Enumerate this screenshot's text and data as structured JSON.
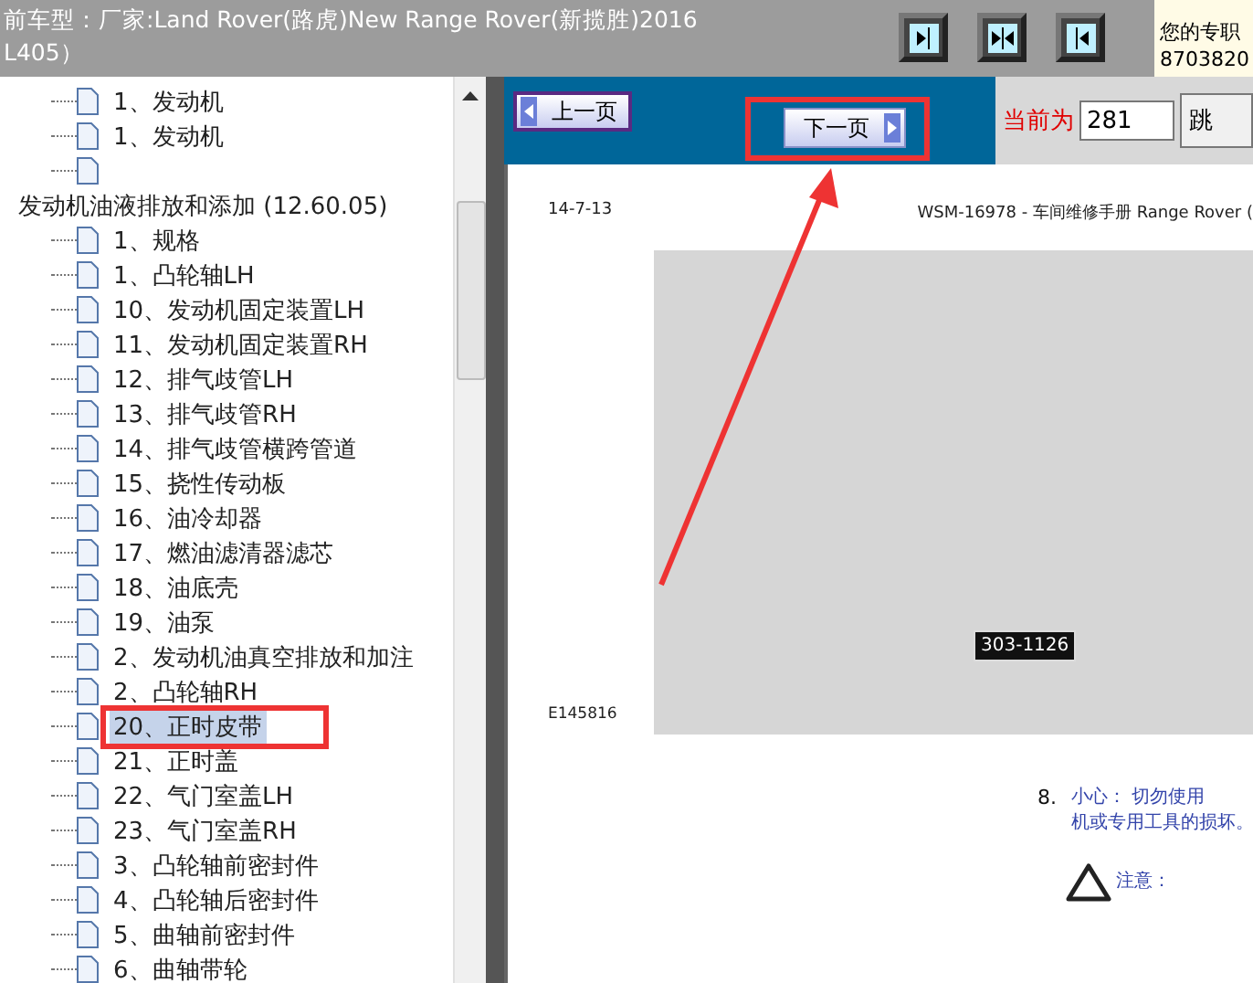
{
  "header": {
    "title_lines": [
      "前车型：厂家:Land Rover(路虎)New Range Rover(新揽胜)2016",
      "L405）"
    ],
    "nav_buttons": [
      {
        "kind": "right"
      },
      {
        "kind": "both"
      },
      {
        "kind": "left"
      }
    ],
    "info_lines": [
      "您的专职",
      "8703820"
    ]
  },
  "tree": [
    {
      "children": [
        {
          "label": "1、发动机",
          "selected": false
        },
        {
          "label": "1、发动机",
          "selected": false
        },
        {
          "selected": false
        }
      ]
    },
    {
      "label": "发动机油液排放和添加 (12.60.05)",
      "expanded": true,
      "children": [
        {
          "label": "1、规格",
          "selected": false
        },
        {
          "label": "1、凸轮轴LH",
          "selected": false
        },
        {
          "label": "10、发动机固定装置LH",
          "selected": false
        },
        {
          "label": "11、发动机固定装置RH",
          "selected": false
        },
        {
          "label": "12、排气歧管LH",
          "selected": false
        },
        {
          "label": "13、排气歧管RH",
          "selected": false
        },
        {
          "label": "14、排气歧管横跨管道",
          "selected": false
        },
        {
          "label": "15、挠性传动板",
          "selected": false
        },
        {
          "label": "16、油冷却器",
          "selected": false
        },
        {
          "label": "17、燃油滤清器滤芯",
          "selected": false
        },
        {
          "label": "18、油底壳",
          "selected": false
        },
        {
          "label": "19、油泵",
          "selected": false
        },
        {
          "label": "2、发动机油真空排放和加注",
          "selected": false
        },
        {
          "label": "2、凸轮轴RH",
          "selected": false
        },
        {
          "label": "20、正时皮带",
          "selected": true
        },
        {
          "label": "21、正时盖",
          "selected": false
        },
        {
          "label": "22、气门室盖LH",
          "selected": false
        },
        {
          "label": "23、气门室盖RH",
          "selected": false
        },
        {
          "label": "3、凸轮轴前密封件",
          "selected": false
        },
        {
          "label": "4、凸轮轴后密封件",
          "selected": false
        },
        {
          "label": "5、曲轴前密封件",
          "selected": false
        },
        {
          "label": "6、曲轴带轮",
          "selected": false
        }
      ]
    }
  ],
  "toolbar": {
    "prev": "上一页",
    "next": "下一页",
    "current_label": "当前为",
    "current_page": "281",
    "jump": "跳"
  },
  "document": {
    "date": "14-7-13",
    "manual_title": "WSM-16978 - 车间维修手册 Range Rover (",
    "callout": "303-1126",
    "figure_id": "E145816",
    "step_number": "8.",
    "caution_lines": [
      "小心： 切勿使用",
      "机或专用工具的损坏。"
    ],
    "note": "注意："
  }
}
